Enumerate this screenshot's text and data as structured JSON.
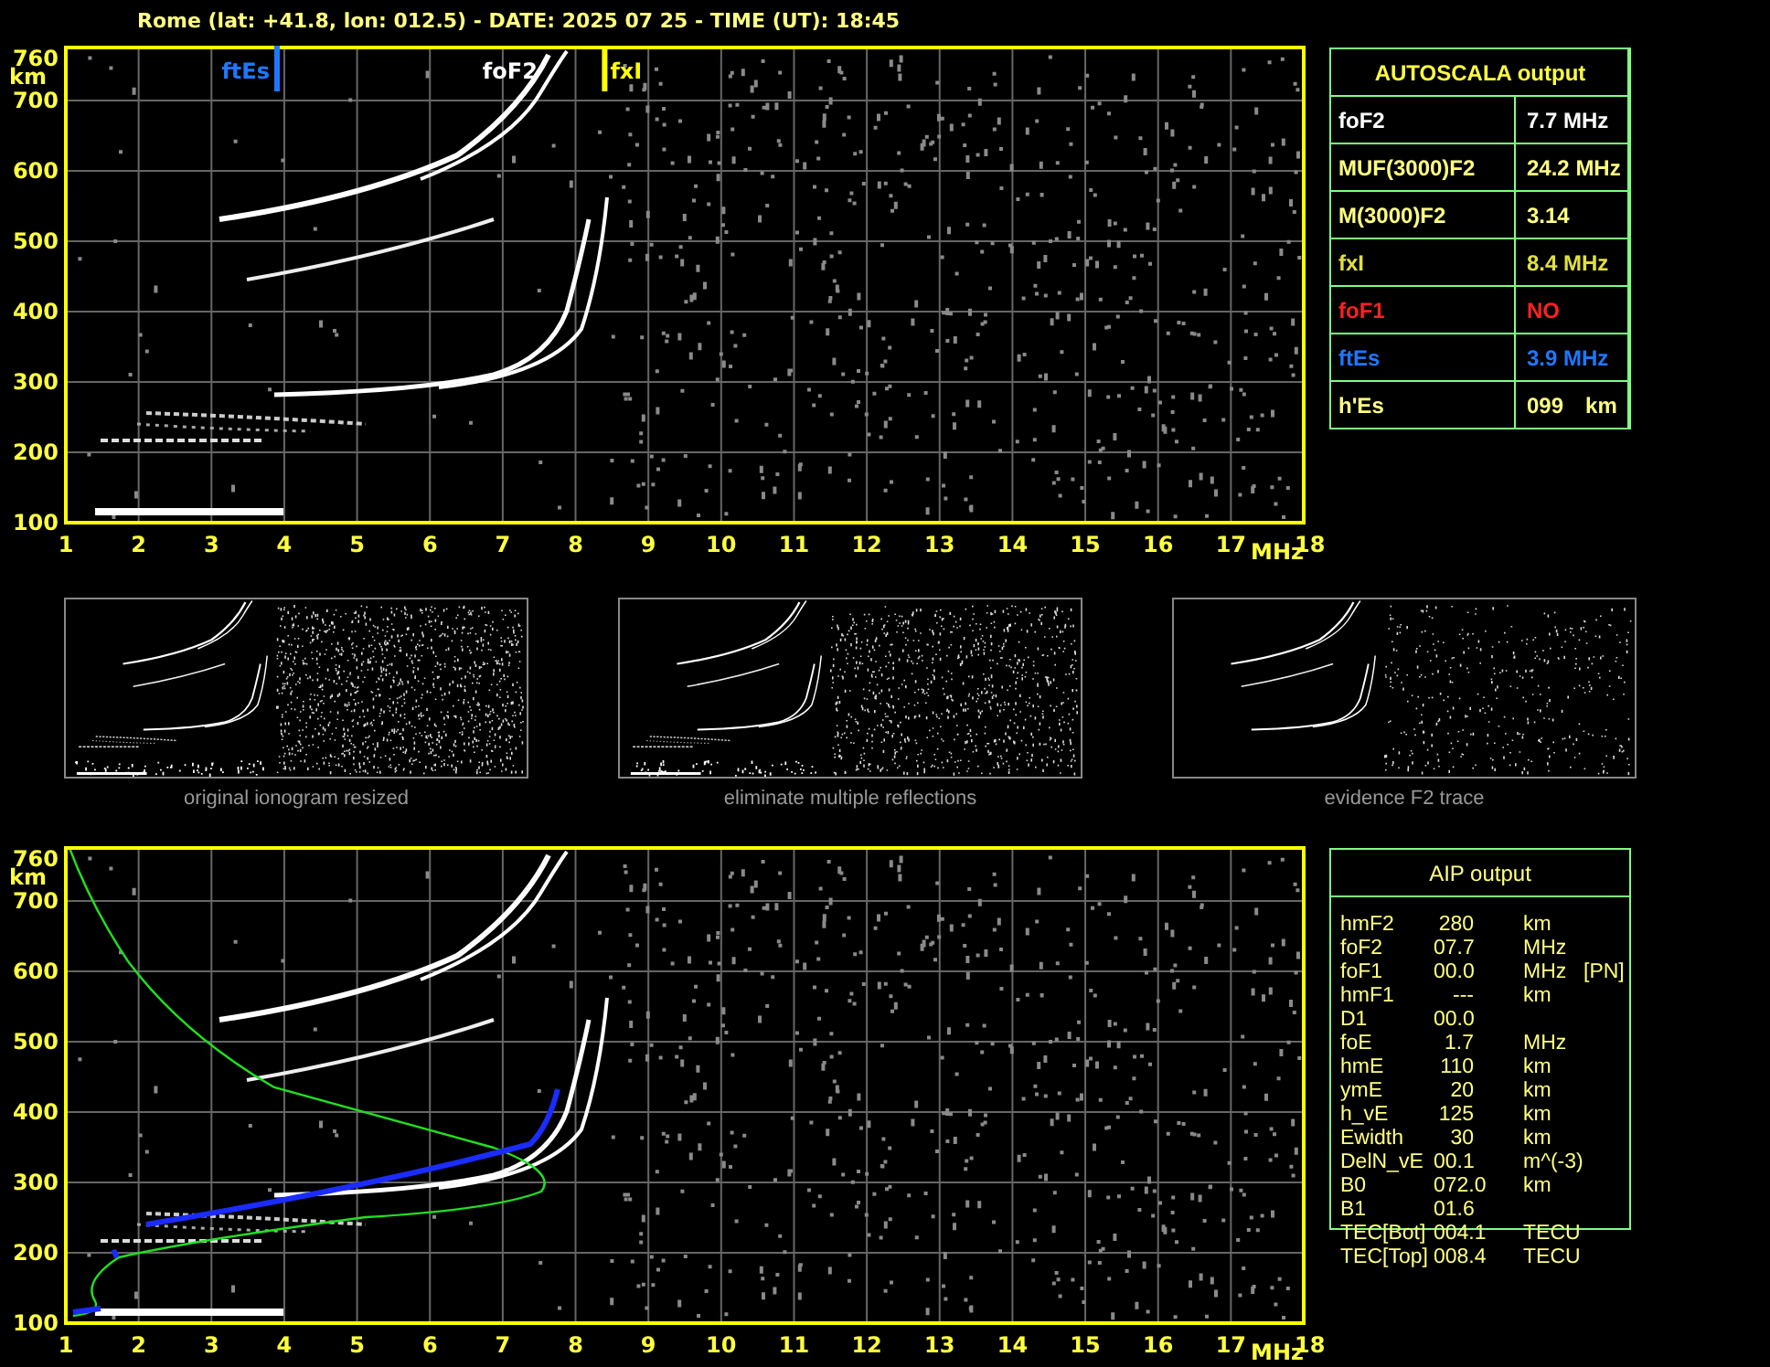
{
  "header": {
    "title": "Rome (lat: +41.8, lon: 012.5) - DATE: 2025 07 25 - TIME (UT): 18:45"
  },
  "ionogram": {
    "y_ticks": [
      "760",
      "700",
      "600",
      "500",
      "400",
      "300",
      "200",
      "100"
    ],
    "y_unit": "km",
    "x_ticks": [
      "1",
      "2",
      "3",
      "4",
      "5",
      "6",
      "7",
      "8",
      "9",
      "10",
      "11",
      "12",
      "13",
      "14",
      "15",
      "16",
      "17",
      "18"
    ],
    "x_unit": "MHz",
    "markers": [
      {
        "kind": "line",
        "label": "ftEs",
        "color": "#1e78ff"
      },
      {
        "kind": "label",
        "label": "foF2",
        "color": "#ffffff"
      },
      {
        "kind": "line",
        "label": "fxI",
        "color": "#ffff00"
      }
    ]
  },
  "autoscala": {
    "title": "AUTOSCALA output",
    "rows": [
      {
        "label": "foF2",
        "value": "7.7 MHz",
        "color": "#ffffff"
      },
      {
        "label": "MUF(3000)F2",
        "value": "24.2 MHz",
        "color": "#ffff80"
      },
      {
        "label": "M(3000)F2",
        "value": "3.14",
        "color": "#ffff80"
      },
      {
        "label": "fxI",
        "value": "8.4 MHz",
        "color": "#e0e040"
      },
      {
        "label": "foF1",
        "value": "NO",
        "color": "#ff2020"
      },
      {
        "label": "ftEs",
        "value": "3.9 MHz",
        "color": "#1e78ff"
      },
      {
        "label": "h'Es",
        "value": "099",
        "unit": "km",
        "color": "#ffff80"
      }
    ]
  },
  "thumbnails": [
    {
      "kind": "original",
      "caption": "original ionogram resized"
    },
    {
      "kind": "filtered",
      "caption": "eliminate multiple reflections"
    },
    {
      "kind": "f2",
      "caption": "evidence F2 trace"
    }
  ],
  "profile_plot": {
    "y_ticks": [
      "760",
      "700",
      "600",
      "500",
      "400",
      "300",
      "200",
      "100"
    ],
    "y_unit": "km",
    "x_ticks": [
      "1",
      "2",
      "3",
      "4",
      "5",
      "6",
      "7",
      "8",
      "9",
      "10",
      "11",
      "12",
      "13",
      "14",
      "15",
      "16",
      "17",
      "18"
    ],
    "x_unit": "MHz"
  },
  "aip": {
    "title": "AIP output",
    "rows": [
      {
        "name": "hmF2",
        "value": "280",
        "unit": "km"
      },
      {
        "name": "foF2",
        "value": "07.7",
        "unit": "MHz"
      },
      {
        "name": "foF1",
        "value": "00.0",
        "unit": "MHz",
        "note": "[PN]"
      },
      {
        "name": "hmF1",
        "value": "---",
        "unit": "km"
      },
      {
        "name": "D1",
        "value": "00.0"
      },
      {
        "name": "foE",
        "value": "1.7",
        "unit": "MHz"
      },
      {
        "name": "hmE",
        "value": "110",
        "unit": "km"
      },
      {
        "name": "ymE",
        "value": "20",
        "unit": "km"
      },
      {
        "name": "h_vE",
        "value": "125",
        "unit": "km"
      },
      {
        "name": "Ewidth",
        "value": "30",
        "unit": "km"
      },
      {
        "name": "DelN_vE",
        "value": "00.1",
        "unit": "m^(-3)"
      },
      {
        "name": "B0",
        "value": "072.0",
        "unit": "km"
      },
      {
        "name": "B1",
        "value": "01.6"
      },
      {
        "name": "TEC[Bot]",
        "value": "004.1",
        "unit": "TECU"
      },
      {
        "name": "TEC[Top]",
        "value": "008.4",
        "unit": "TECU"
      }
    ]
  }
}
